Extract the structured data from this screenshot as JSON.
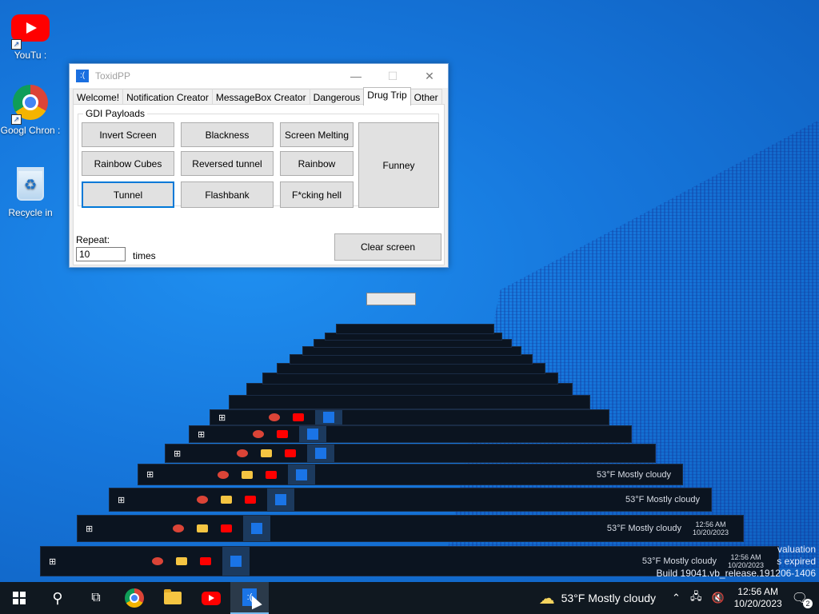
{
  "desktop": {
    "icons": [
      {
        "label": "YouTu :",
        "icon": "youtube-icon"
      },
      {
        "label": "Googl  Chron :",
        "icon": "chrome-icon"
      },
      {
        "label": "Recycle  in",
        "icon": "recycle-bin-icon"
      }
    ],
    "ghost_taskbar": {
      "weather": "53°F  Mostly cloudy",
      "time": "12:56 AM",
      "date": "10/20/2023"
    },
    "evaluation_text": {
      "line1": "valuation",
      "line2": "s expired",
      "line3": "Build 19041.vb_release.191206-1406"
    }
  },
  "window": {
    "title": "ToxidPP",
    "app_icon_glyph": ":(",
    "controls": {
      "minimize": "—",
      "maximize": "☐",
      "close": "✕"
    },
    "tabs": [
      "Welcome!",
      "Notification Creator",
      "MessageBox Creator",
      "Dangerous",
      "Drug Trip",
      "Other"
    ],
    "active_tab": "Drug Trip",
    "group_title": "GDI Payloads",
    "buttons": {
      "invert": "Invert Screen",
      "blackness": "Blackness",
      "melting": "Screen Melting",
      "funney": "Funney",
      "rainbow_cubes": "Rainbow Cubes",
      "reversed_tunnel": "Reversed tunnel",
      "rainbow": "Rainbow",
      "tunnel": "Tunnel",
      "flashbank": "Flashbank",
      "fcking_hell": "F*cking hell",
      "clear": "Clear screen"
    },
    "repeat_label": "Repeat:",
    "repeat_value": "10",
    "times_label": "times"
  },
  "taskbar": {
    "weather": "53°F  Mostly cloudy",
    "time": "12:56 AM",
    "date": "10/20/2023",
    "notification_count": "2",
    "colors": {
      "background": "#101820",
      "accent": "#1a74e6"
    }
  }
}
